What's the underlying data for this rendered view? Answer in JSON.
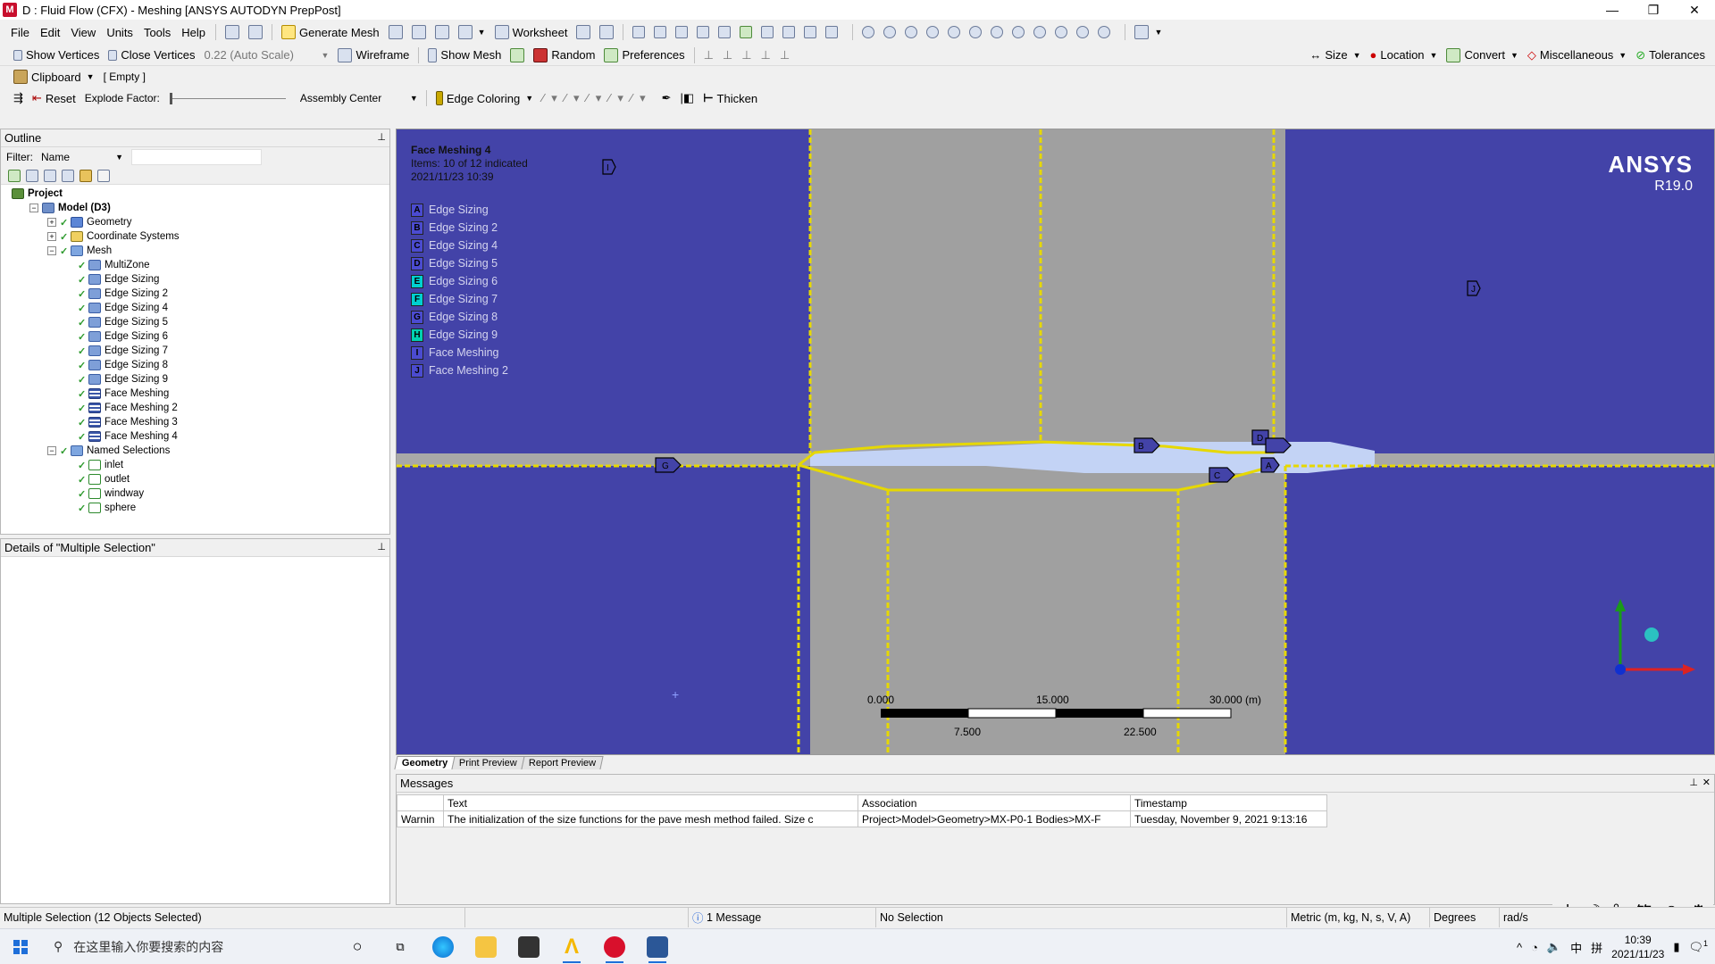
{
  "window": {
    "title": "D : Fluid Flow (CFX) - Meshing [ANSYS AUTODYN PrepPost]",
    "app_icon": "M",
    "controls": [
      "—",
      "❐",
      "✕"
    ]
  },
  "menu": {
    "items": [
      "File",
      "Edit",
      "View",
      "Units",
      "Tools",
      "Help"
    ],
    "generate_mesh": "Generate Mesh",
    "worksheet": "Worksheet"
  },
  "toolbar2": {
    "show_vertices": "Show Vertices",
    "close_vertices": "Close Vertices",
    "auto_scale": "0.22 (Auto Scale)",
    "wireframe": "Wireframe",
    "show_mesh": "Show Mesh",
    "random": "Random",
    "preferences": "Preferences",
    "size": "Size",
    "location": "Location",
    "convert": "Convert",
    "miscellaneous": "Miscellaneous",
    "tolerances": "Tolerances"
  },
  "toolbar3": {
    "clipboard": "Clipboard",
    "clipboard_state": "[ Empty ]"
  },
  "toolbar4": {
    "reset": "Reset",
    "explode_factor": "Explode Factor:",
    "assembly_center": "Assembly Center",
    "edge_coloring": "Edge Coloring",
    "thicken": "Thicken"
  },
  "outline": {
    "title": "Outline",
    "filter_label": "Filter:",
    "filter_value": "Name",
    "tree": [
      {
        "label": "Project",
        "level": 0,
        "icon": "project-icon",
        "bold": true,
        "exp": ""
      },
      {
        "label": "Model (D3)",
        "level": 1,
        "icon": "model-icon",
        "bold": true,
        "exp": "−"
      },
      {
        "label": "Geometry",
        "level": 2,
        "icon": "geometry-icon",
        "exp": "+"
      },
      {
        "label": "Coordinate Systems",
        "level": 2,
        "icon": "coordinate-systems-icon",
        "exp": "+"
      },
      {
        "label": "Mesh",
        "level": 2,
        "icon": "mesh-icon",
        "exp": "−"
      },
      {
        "label": "MultiZone",
        "level": 3,
        "icon": "multizone-icon",
        "exp": ""
      },
      {
        "label": "Edge Sizing",
        "level": 3,
        "icon": "edge-sizing-icon",
        "exp": ""
      },
      {
        "label": "Edge Sizing 2",
        "level": 3,
        "icon": "edge-sizing-icon",
        "exp": ""
      },
      {
        "label": "Edge Sizing 4",
        "level": 3,
        "icon": "edge-sizing-icon",
        "exp": ""
      },
      {
        "label": "Edge Sizing 5",
        "level": 3,
        "icon": "edge-sizing-icon",
        "exp": ""
      },
      {
        "label": "Edge Sizing 6",
        "level": 3,
        "icon": "edge-sizing-icon",
        "exp": ""
      },
      {
        "label": "Edge Sizing 7",
        "level": 3,
        "icon": "edge-sizing-icon",
        "exp": ""
      },
      {
        "label": "Edge Sizing 8",
        "level": 3,
        "icon": "edge-sizing-icon",
        "exp": ""
      },
      {
        "label": "Edge Sizing 9",
        "level": 3,
        "icon": "edge-sizing-icon",
        "exp": ""
      },
      {
        "label": "Face Meshing",
        "level": 3,
        "icon": "face-meshing-icon",
        "exp": ""
      },
      {
        "label": "Face Meshing 2",
        "level": 3,
        "icon": "face-meshing-icon",
        "exp": ""
      },
      {
        "label": "Face Meshing 3",
        "level": 3,
        "icon": "face-meshing-icon",
        "exp": ""
      },
      {
        "label": "Face Meshing 4",
        "level": 3,
        "icon": "face-meshing-icon",
        "exp": ""
      },
      {
        "label": "Named Selections",
        "level": 2,
        "icon": "named-selections-icon",
        "exp": "−"
      },
      {
        "label": "inlet",
        "level": 3,
        "icon": "named-selection-icon",
        "exp": ""
      },
      {
        "label": "outlet",
        "level": 3,
        "icon": "named-selection-icon",
        "exp": ""
      },
      {
        "label": "windway",
        "level": 3,
        "icon": "named-selection-icon",
        "exp": ""
      },
      {
        "label": "sphere",
        "level": 3,
        "icon": "named-selection-icon",
        "exp": ""
      }
    ]
  },
  "details": {
    "title": "Details of \"Multiple Selection\""
  },
  "viewport": {
    "info_title": "Face Meshing 4",
    "info_items": "Items: 10 of 12 indicated",
    "info_date": "2021/11/23 10:39",
    "legend": [
      {
        "key": "A",
        "label": "Edge Sizing"
      },
      {
        "key": "B",
        "label": "Edge Sizing 2"
      },
      {
        "key": "C",
        "label": "Edge Sizing 4"
      },
      {
        "key": "D",
        "label": "Edge Sizing 5"
      },
      {
        "key": "E",
        "label": "Edge Sizing 6"
      },
      {
        "key": "F",
        "label": "Edge Sizing 7"
      },
      {
        "key": "G",
        "label": "Edge Sizing 8"
      },
      {
        "key": "H",
        "label": "Edge Sizing 9"
      },
      {
        "key": "I",
        "label": "Face Meshing"
      },
      {
        "key": "J",
        "label": "Face Meshing 2"
      }
    ],
    "logo": "ANSYS",
    "version": "R19.0",
    "scale_labels_top": [
      "0.000",
      "15.000",
      "30.000 (m)"
    ],
    "scale_labels_bottom": [
      "7.500",
      "22.500"
    ],
    "tabs": [
      "Geometry",
      "Print Preview",
      "Report Preview"
    ],
    "colors": {
      "background": "#4343a8",
      "channel": "#a0a0a0",
      "edge": "#e6d800",
      "selected_face": "#c3d3f5"
    }
  },
  "messages": {
    "title": "Messages",
    "columns": [
      "",
      "Text",
      "Association",
      "Timestamp"
    ],
    "rows": [
      {
        "type": "Warnin",
        "text": "The initialization of the size functions for the pave mesh method failed. Size c",
        "association": "Project>Model>Geometry>MX-P0-1 Bodies>MX-F",
        "timestamp": "Tuesday, November 9, 2021 9:13:16"
      }
    ]
  },
  "status": {
    "selection": "Multiple Selection (12 Objects Selected)",
    "message_count": "1 Message",
    "no_selection": "No Selection",
    "units": "Metric (m, kg, N, s, V, A)",
    "angle": "Degrees",
    "rate": "rad/s"
  },
  "ime": [
    "中",
    "☽",
    "°,",
    "简",
    "☺",
    "⚙"
  ],
  "taskbar": {
    "search_placeholder": "在这里输入你要搜索的内容",
    "tray": [
      "^",
      "中",
      "拼"
    ],
    "time": "10:39",
    "date": "2021/11/23",
    "notification_count": "1"
  }
}
